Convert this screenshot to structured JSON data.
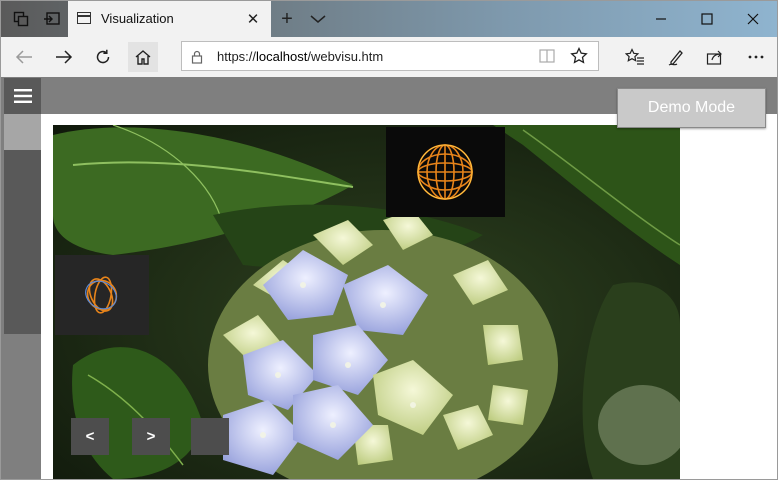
{
  "browser": {
    "tab_title": "Visualization",
    "tab_close": "✕",
    "new_tab": "+",
    "address": {
      "scheme": "https://",
      "host": "localhost",
      "path": "/webvisu.htm"
    }
  },
  "page": {
    "demo_button": "Demo Mode",
    "nav_prev": "<",
    "nav_next": ">"
  },
  "icons": [
    "tab-actions-icon",
    "set-aside-tabs-icon",
    "tab-page-icon",
    "close-icon",
    "plus-icon",
    "chevron-down-icon",
    "minimize-icon",
    "maximize-icon",
    "close-window-icon",
    "back-icon",
    "forward-icon",
    "refresh-icon",
    "home-icon",
    "lock-icon",
    "reading-view-icon",
    "favorite-star-icon",
    "favorites-icon",
    "pen-icon",
    "share-icon",
    "more-icon",
    "hamburger-icon"
  ]
}
